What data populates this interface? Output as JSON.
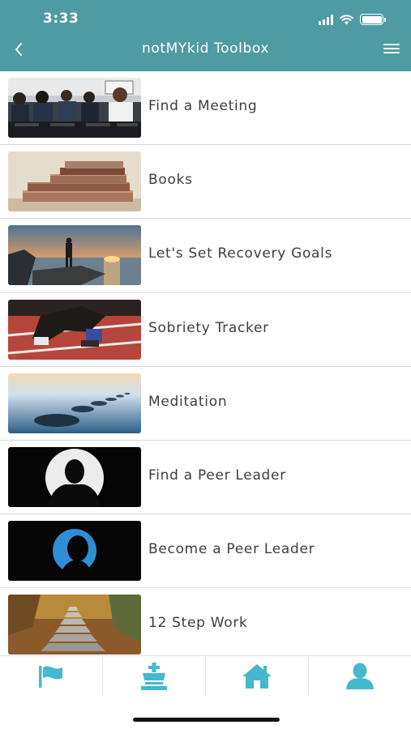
{
  "status_bar": {
    "time": "3:33"
  },
  "header": {
    "title": "notMYkid Toolbox"
  },
  "list": {
    "items": [
      {
        "label": "Find a Meeting",
        "image": "meeting-photo"
      },
      {
        "label": "Books",
        "image": "books-photo"
      },
      {
        "label": "Let's Set Recovery Goals",
        "image": "sunset-hiker-photo"
      },
      {
        "label": "Sobriety Tracker",
        "image": "runner-start-photo"
      },
      {
        "label": "Meditation",
        "image": "stepping-stones-photo"
      },
      {
        "label": "Find a Peer Leader",
        "image": "silhouette-photo"
      },
      {
        "label": "Become a Peer Leader",
        "image": "blue-profile-photo"
      },
      {
        "label": "12 Step Work",
        "image": "stone-stairs-photo"
      }
    ]
  },
  "tab_bar": {
    "tabs": [
      {
        "icon": "flag-icon"
      },
      {
        "icon": "chess-king-icon"
      },
      {
        "icon": "home-icon"
      },
      {
        "icon": "user-icon"
      }
    ]
  },
  "colors": {
    "header": "#4e9ba3",
    "accent": "#44b8cc",
    "text": "#3d3d3d"
  }
}
